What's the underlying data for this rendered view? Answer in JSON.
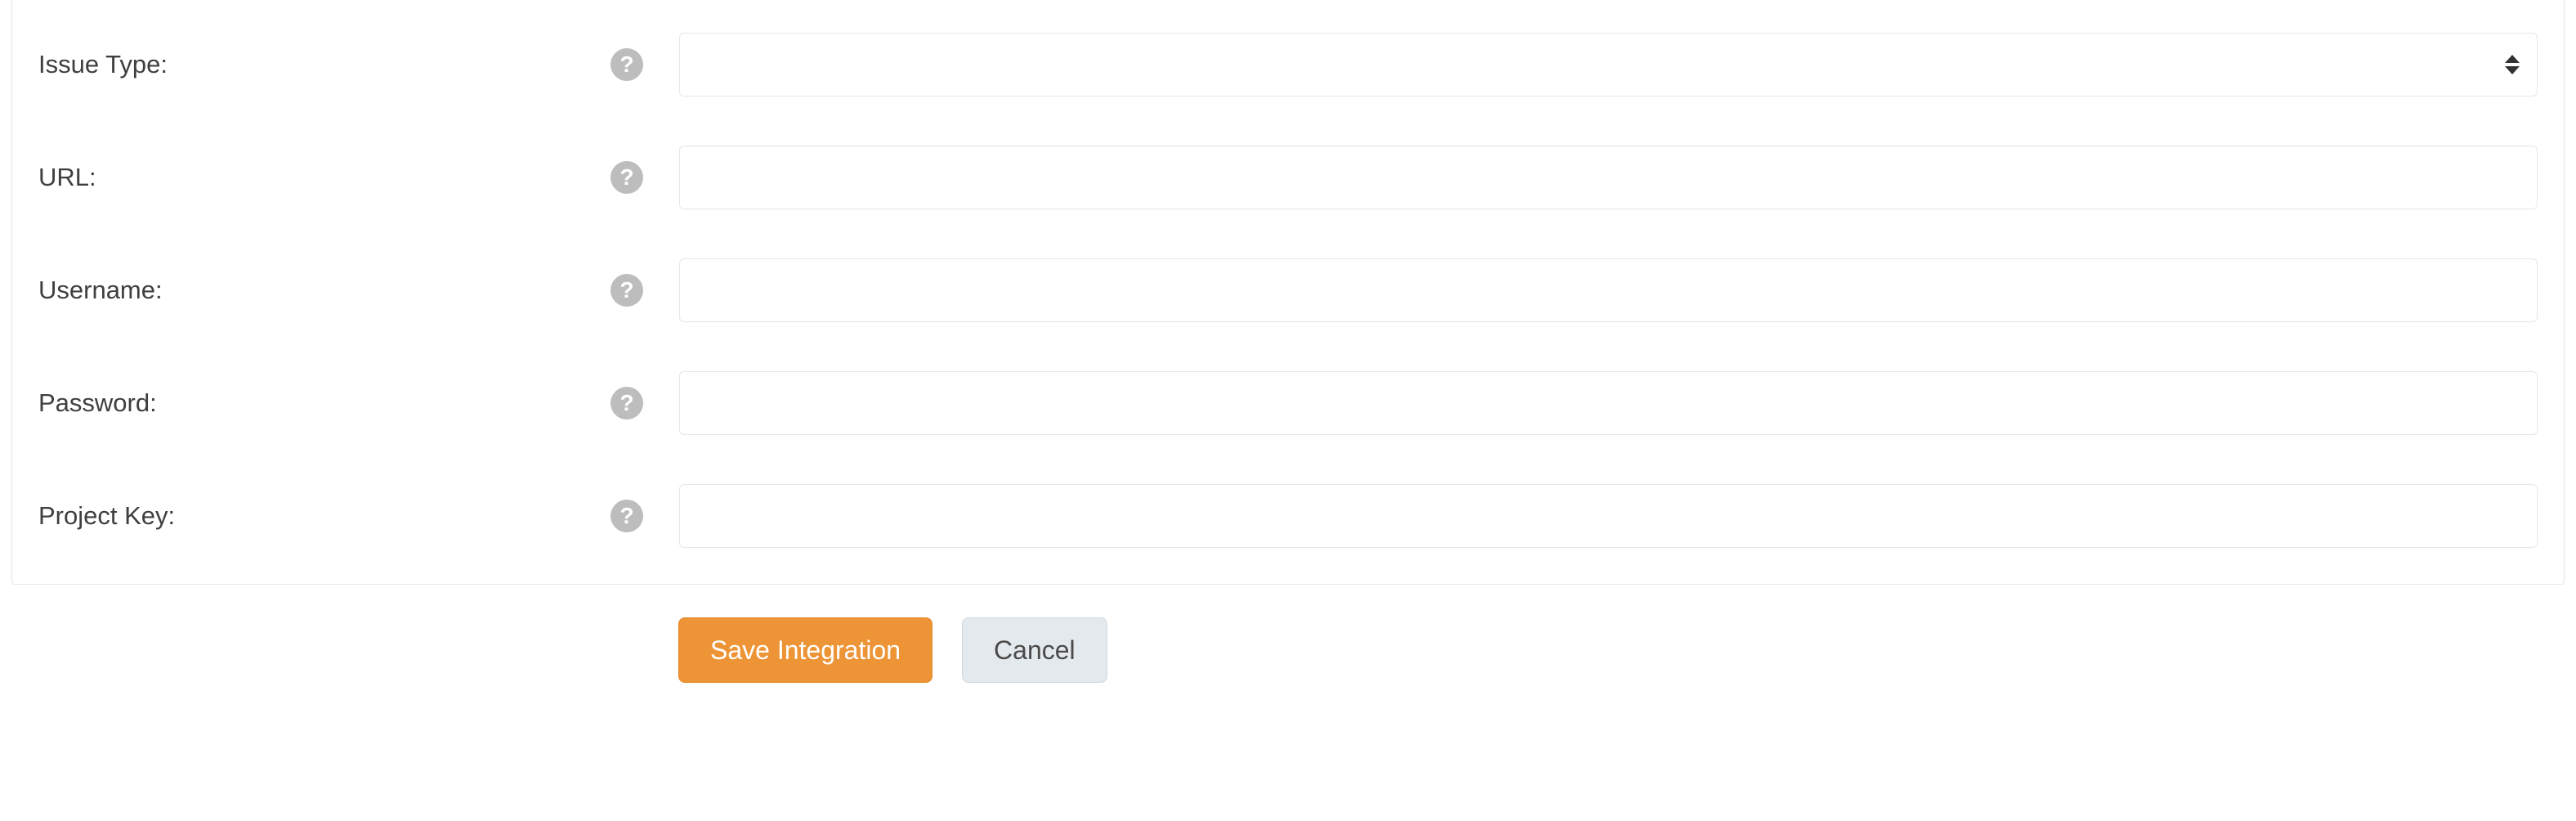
{
  "form": {
    "fields": {
      "issue_type": {
        "label": "Issue Type:",
        "value": ""
      },
      "url": {
        "label": "URL:",
        "value": ""
      },
      "username": {
        "label": "Username:",
        "value": ""
      },
      "password": {
        "label": "Password:",
        "value": ""
      },
      "project_key": {
        "label": "Project Key:",
        "value": ""
      }
    }
  },
  "buttons": {
    "save": "Save Integration",
    "cancel": "Cancel"
  },
  "icons": {
    "help_glyph": "?"
  }
}
